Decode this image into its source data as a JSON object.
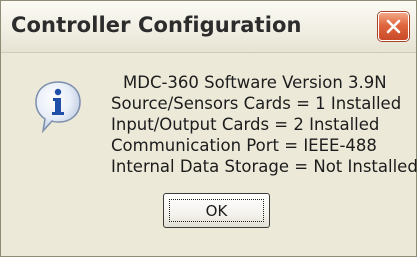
{
  "window": {
    "title": "Controller Configuration",
    "close_icon": "close-icon",
    "colors": {
      "close_button": "#d9582f",
      "dialog_bg": "#ece9d8"
    }
  },
  "message": {
    "icon": "info-icon",
    "lines": [
      "MDC-360 Software Version 3.9N",
      "Source/Sensors Cards =  1 Installed",
      "Input/Output Cards =  2 Installed",
      "Communication Port = IEEE-488",
      "Internal Data Storage = Not Installed"
    ]
  },
  "buttons": {
    "ok_label": "OK"
  }
}
